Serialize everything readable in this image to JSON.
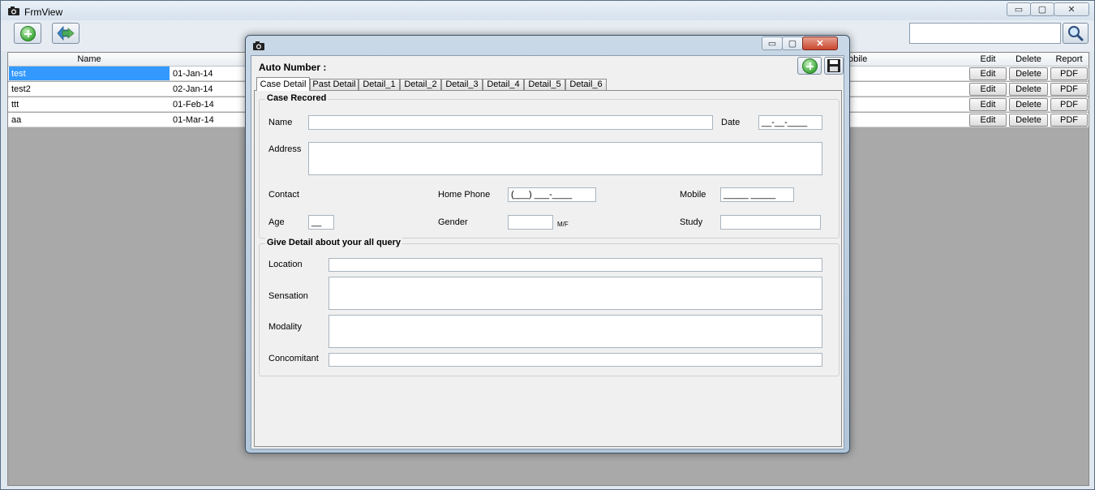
{
  "main": {
    "title": "FrmView",
    "controls": {
      "minimize": "▭",
      "maximize": "▢",
      "close": "✕"
    }
  },
  "toolbar": {
    "add_icon": "plus-circle-icon",
    "refresh_icon": "transfer-arrows-icon",
    "search_value": "",
    "search_icon": "magnifier-icon"
  },
  "grid": {
    "columns": [
      "Name",
      "obile",
      "Edit",
      "Delete",
      "Report"
    ],
    "rows": [
      {
        "name": "test",
        "date": "01-Jan-14",
        "edit": "Edit",
        "delete": "Delete",
        "report": "PDF"
      },
      {
        "name": "test2",
        "date": "02-Jan-14",
        "edit": "Edit",
        "delete": "Delete",
        "report": "PDF"
      },
      {
        "name": "ttt",
        "date": "01-Feb-14",
        "edit": "Edit",
        "delete": "Delete",
        "report": "PDF"
      },
      {
        "name": "aa",
        "date": "01-Mar-14",
        "edit": "Edit",
        "delete": "Delete",
        "report": "PDF"
      }
    ]
  },
  "dialog": {
    "controls": {
      "minimize": "▭",
      "maximize": "▢",
      "close": "✕"
    },
    "auto_number_label": "Auto Number :",
    "tabs": [
      "Case Detail",
      "Past Detail",
      "Detail_1",
      "Detail_2",
      "Detail_3",
      "Detail_4",
      "Detail_5",
      "Detail_6"
    ],
    "case_section": {
      "title": "Case Recored",
      "name_label": "Name",
      "date_label": "Date",
      "date_mask": "__-__-____",
      "address_label": "Address",
      "contact_label": "Contact",
      "home_phone_label": "Home Phone",
      "home_phone_mask": "(___) ___-____",
      "mobile_label": "Mobile",
      "mobile_mask": "_____ _____",
      "age_label": "Age",
      "age_mask": "__",
      "gender_label": "Gender",
      "gender_hint": "M/F",
      "study_label": "Study"
    },
    "query_section": {
      "title": "Give Detail about your all query",
      "location_label": "Location",
      "sensation_label": "Sensation",
      "modality_label": "Modality",
      "concomitant_label": "Concomitant"
    }
  }
}
